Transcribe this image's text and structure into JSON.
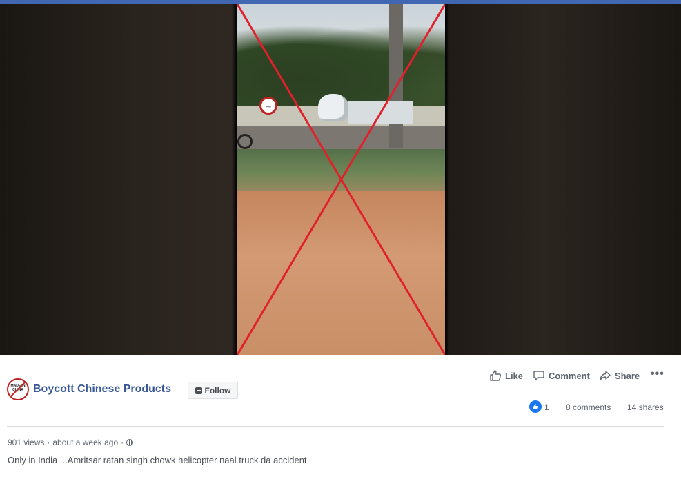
{
  "post": {
    "page_name": "Boycott Chinese Products",
    "follow_label": "Follow",
    "avatar_text": "MADE IN CHINA",
    "caption": "Only in India ...Amritsar ratan singh chowk helicopter naal truck da accident"
  },
  "actions": {
    "like": "Like",
    "comment": "Comment",
    "share": "Share",
    "more": "•••"
  },
  "stats": {
    "reactions": "1",
    "comments": "8 comments",
    "shares": "14 shares",
    "views": "901 views",
    "time": "about a week ago",
    "separator": "·"
  },
  "icons": [
    "thumbs-up-icon",
    "comment-icon",
    "share-icon",
    "more-icon",
    "globe-icon",
    "follow-icon"
  ],
  "colors": {
    "brand_bar": "#4267b2",
    "link": "#385898",
    "like_blue": "#1877f2",
    "cross_red": "#e0202a"
  }
}
